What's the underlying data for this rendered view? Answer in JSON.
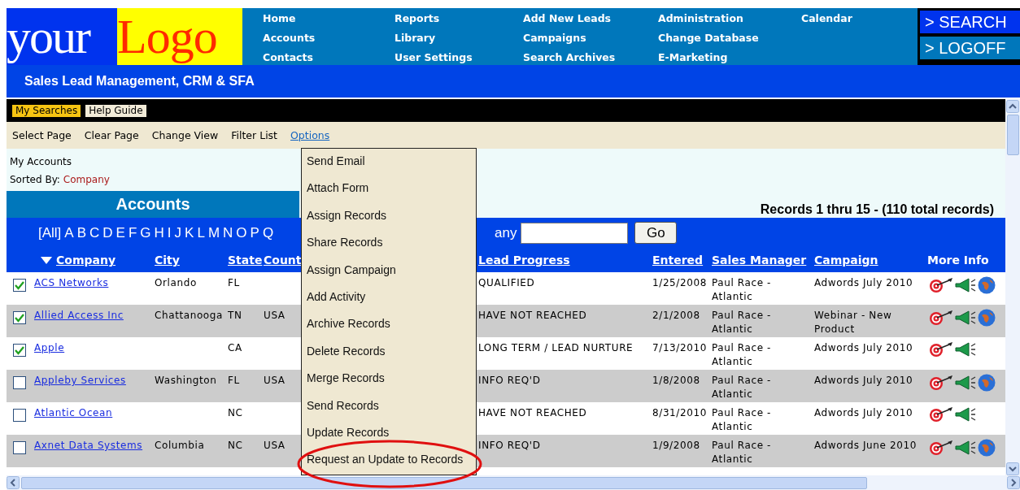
{
  "logo": {
    "part_1": "your",
    "part_2": "Logo"
  },
  "nav": [
    [
      "Home",
      "Accounts",
      "Contacts"
    ],
    [
      "Reports",
      "Library",
      "User Settings"
    ],
    [
      "Add New Leads",
      "Campaigns",
      "Search Archives"
    ],
    [
      "Administration",
      "Change Database",
      "E-Marketing"
    ],
    [
      "Calendar"
    ]
  ],
  "side_buttons": [
    "> SEARCH",
    "> LOGOFF"
  ],
  "subtitle": "Sales Lead Management, CRM & SFA",
  "quick_tabs": [
    {
      "label": "My Searches",
      "selected": true
    },
    {
      "label": "Help Guide",
      "selected": false
    }
  ],
  "toolbar": [
    {
      "label": "Select Page",
      "kind": "plain"
    },
    {
      "label": "Clear Page",
      "kind": "plain"
    },
    {
      "label": "Change View",
      "kind": "plain"
    },
    {
      "label": "Filter List",
      "kind": "plain"
    },
    {
      "label": "Options",
      "kind": "link"
    }
  ],
  "breadcrumb": "My Accounts",
  "sorted_by": {
    "label": "Sorted By:",
    "value": "Company"
  },
  "section_title": "Accounts",
  "records_summary": "Records 1 thru 15 - (110 total records)",
  "letters": [
    "[All]",
    "A",
    "B",
    "C",
    "D",
    "E",
    "F",
    "G",
    "H",
    "I",
    "J",
    "K",
    "L",
    "M",
    "N",
    "O",
    "P",
    "Q"
  ],
  "search": {
    "label": "any",
    "button": "Go"
  },
  "columns": [
    "Company",
    "City",
    "State",
    "Count",
    "Lead Progress",
    "Entered",
    "Sales Manager",
    "Campaign",
    "More Info"
  ],
  "rows": [
    {
      "checked": true,
      "company": "ACS Networks",
      "city": "Orlando",
      "state": "FL",
      "country": "",
      "lead": "QUALIFIED",
      "entered": "1/25/2008",
      "manager": "Paul Race - Atlantic",
      "campaign": "Adwords July 2010",
      "globe": true
    },
    {
      "checked": true,
      "company": "Allied Access Inc",
      "city": "Chattanooga",
      "state": "TN",
      "country": "USA",
      "lead": "HAVE NOT REACHED",
      "entered": "2/1/2008",
      "manager": "Paul Race - Atlantic",
      "campaign": "Webinar - New Product",
      "globe": true
    },
    {
      "checked": true,
      "company": "Apple",
      "city": "",
      "state": "CA",
      "country": "",
      "lead": "LONG TERM / LEAD NURTURE",
      "entered": "7/13/2010",
      "manager": "Paul Race - Atlantic",
      "campaign": "Adwords July 2010",
      "globe": false
    },
    {
      "checked": false,
      "company": "Appleby Services",
      "city": "Washington",
      "state": "FL",
      "country": "USA",
      "lead": "INFO REQ'D",
      "entered": "1/8/2008",
      "manager": "Paul Race - Atlantic",
      "campaign": "Adwords July 2010",
      "globe": true
    },
    {
      "checked": false,
      "company": "Atlantic Ocean",
      "city": "",
      "state": "NC",
      "country": "",
      "lead": "HAVE NOT REACHED",
      "entered": "8/31/2010",
      "manager": "Paul Race - Atlantic",
      "campaign": "Adwords July 2010",
      "globe": false
    },
    {
      "checked": false,
      "company": "Axnet Data Systems",
      "city": "Columbia",
      "state": "NC",
      "country": "USA",
      "lead": "INFO REQ'D",
      "entered": "1/9/2008",
      "manager": "Paul Race - Atlantic",
      "campaign": "Adwords June 2010",
      "globe": true
    }
  ],
  "options_menu": [
    {
      "label": "Send Email",
      "highlighted": false
    },
    {
      "label": "Attach Form",
      "highlighted": false
    },
    {
      "label": "Assign Records",
      "highlighted": false
    },
    {
      "label": "Share Records",
      "highlighted": false
    },
    {
      "label": "Assign Campaign",
      "highlighted": false
    },
    {
      "label": "Add Activity",
      "highlighted": false
    },
    {
      "label": "Archive Records",
      "highlighted": false
    },
    {
      "label": "Delete Records",
      "highlighted": false
    },
    {
      "label": "Merge Records",
      "highlighted": false
    },
    {
      "label": "Send Records",
      "highlighted": false
    },
    {
      "label": "Update Records",
      "highlighted": false
    },
    {
      "label": "Request an Update to Records",
      "highlighted": true
    }
  ]
}
